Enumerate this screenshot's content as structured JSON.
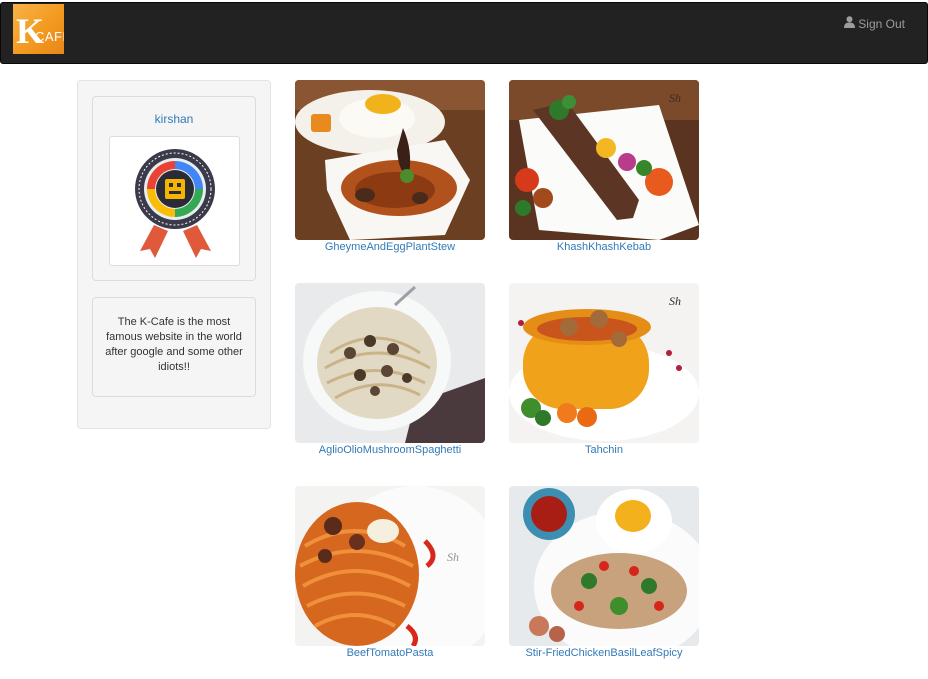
{
  "navbar": {
    "brand_letter": "K",
    "brand_word": "CAFE",
    "signout_label": "Sign Out"
  },
  "sidebar": {
    "username": "kirshan",
    "about": "The K-Cafe is the most famous website in the world after google and some other idiots!!"
  },
  "foods": [
    {
      "name": "GheymeAndEggPlantStew"
    },
    {
      "name": "KhashKhashKebab"
    },
    {
      "name": "AglioOlioMushroomSpaghetti"
    },
    {
      "name": "Tahchin"
    },
    {
      "name": "BeefTomatoPasta"
    },
    {
      "name": "Stir-FriedChickenBasilLeafSpicy"
    }
  ],
  "colors": {
    "navbar_bg": "#222222",
    "link": "#337ab7",
    "well_bg": "#f5f5f5",
    "brand_orange": "#f39a1f"
  }
}
